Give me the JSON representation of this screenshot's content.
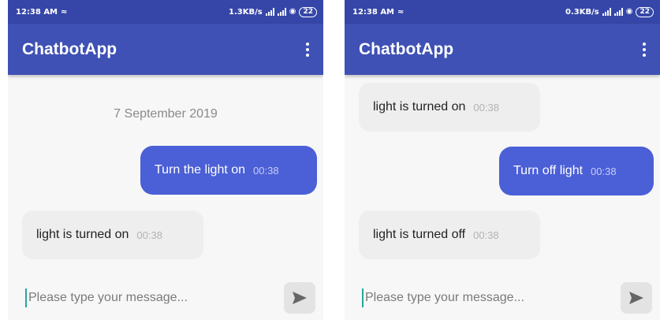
{
  "left": {
    "status": {
      "time": "12:38 AM",
      "network_speed": "1.3KB/s",
      "battery": "22"
    },
    "app_title": "ChatbotApp",
    "date_separator": "7 September 2019",
    "messages": [
      {
        "sender": "user",
        "text": "Turn the light on",
        "time": "00:38"
      },
      {
        "sender": "bot",
        "text": "light is turned on",
        "time": "00:38"
      }
    ],
    "input": {
      "placeholder": "Please type your message..."
    }
  },
  "right": {
    "status": {
      "time": "12:38 AM",
      "network_speed": "0.3KB/s",
      "battery": "22"
    },
    "app_title": "ChatbotApp",
    "messages": [
      {
        "sender": "bot",
        "text": "light is turned on",
        "time": "00:38"
      },
      {
        "sender": "user",
        "text": "Turn off light",
        "time": "00:38"
      },
      {
        "sender": "bot",
        "text": "light is turned off",
        "time": "00:38"
      }
    ],
    "input": {
      "placeholder": "Please type your message..."
    }
  },
  "colors": {
    "app_bar": "#3f51b5",
    "status_bar": "#3546a8",
    "sent_bubble": "#4b5fd6",
    "received_bubble": "#eeeeee",
    "cursor": "#26a69a"
  },
  "icons": {
    "overflow": "more-vertical-icon",
    "send": "send-icon",
    "signal": "signal-icon",
    "wifi": "wifi-icon"
  }
}
